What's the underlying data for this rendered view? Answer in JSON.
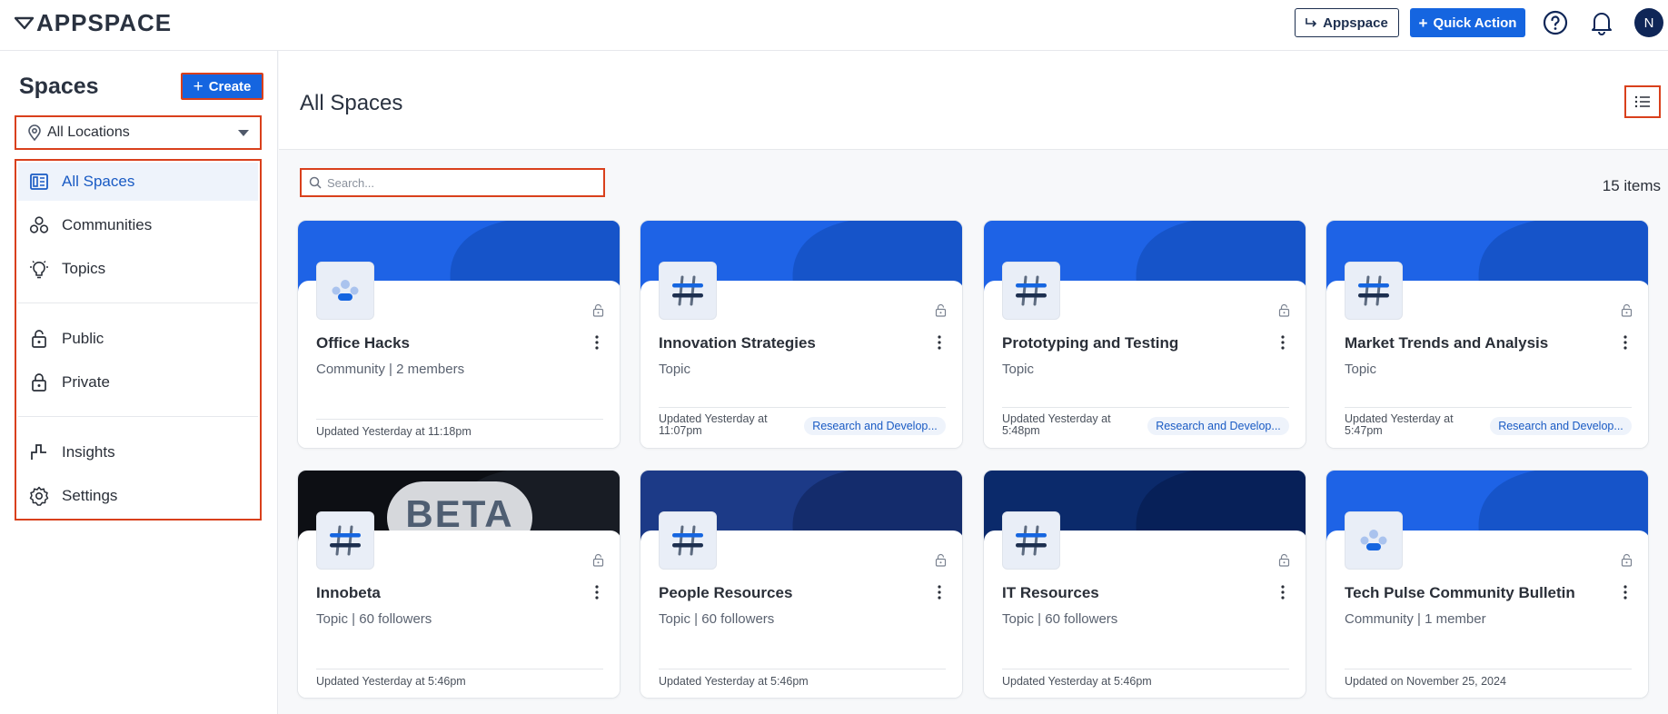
{
  "header": {
    "logo_text": "APPSPACE",
    "appspace_button": "Appspace",
    "quick_action_button": "Quick Action",
    "avatar_initial": "N"
  },
  "sidebar": {
    "title": "Spaces",
    "create_button": "Create",
    "location_select": "All Locations",
    "nav": [
      {
        "label": "All Spaces",
        "icon": "all-spaces-icon",
        "active": true
      },
      {
        "label": "Communities",
        "icon": "communities-icon"
      },
      {
        "label": "Topics",
        "icon": "lightbulb-icon"
      },
      {
        "label": "Public",
        "icon": "unlock-icon"
      },
      {
        "label": "Private",
        "icon": "lock-icon"
      },
      {
        "label": "Insights",
        "icon": "insights-icon"
      },
      {
        "label": "Settings",
        "icon": "gear-icon"
      }
    ]
  },
  "main": {
    "title": "All Spaces",
    "search_placeholder": "Search...",
    "item_count": "15 items",
    "cards": [
      {
        "name": "Office Hacks",
        "subtitle": "Community | 2 members",
        "updated": "Updated Yesterday at 11:18pm",
        "tag": "",
        "icon": "community-icon",
        "banner": "blue"
      },
      {
        "name": "Innovation Strategies",
        "subtitle": "Topic",
        "updated": "Updated Yesterday at 11:07pm",
        "tag": "Research and Develop...",
        "icon": "hashtag-icon",
        "banner": "blue"
      },
      {
        "name": "Prototyping and Testing",
        "subtitle": "Topic",
        "updated": "Updated Yesterday at 5:48pm",
        "tag": "Research and Develop...",
        "icon": "hashtag-icon",
        "banner": "blue"
      },
      {
        "name": "Market Trends and Analysis",
        "subtitle": "Topic",
        "updated": "Updated Yesterday at 5:47pm",
        "tag": "Research and Develop...",
        "icon": "hashtag-icon",
        "banner": "blue"
      },
      {
        "name": "Innobeta",
        "subtitle": "Topic | 60 followers",
        "updated": "Updated Yesterday at 5:46pm",
        "tag": "",
        "icon": "hashtag-icon",
        "banner": "black",
        "banner_text": "BETA"
      },
      {
        "name": "People Resources",
        "subtitle": "Topic | 60 followers",
        "updated": "Updated Yesterday at 5:46pm",
        "tag": "",
        "icon": "hashtag-icon",
        "banner": "navy"
      },
      {
        "name": "IT Resources",
        "subtitle": "Topic | 60 followers",
        "updated": "Updated Yesterday at 5:46pm",
        "tag": "",
        "icon": "hashtag-icon",
        "banner": "darknavy"
      },
      {
        "name": "Tech Pulse Community Bulletin",
        "subtitle": "Community | 1 member",
        "updated": "Updated on November 25, 2024",
        "tag": "",
        "icon": "community-icon",
        "banner": "blue"
      }
    ]
  },
  "colors": {
    "accent": "#1565e0",
    "highlight_border": "#d9401c",
    "dark_navy": "#0f2657"
  }
}
